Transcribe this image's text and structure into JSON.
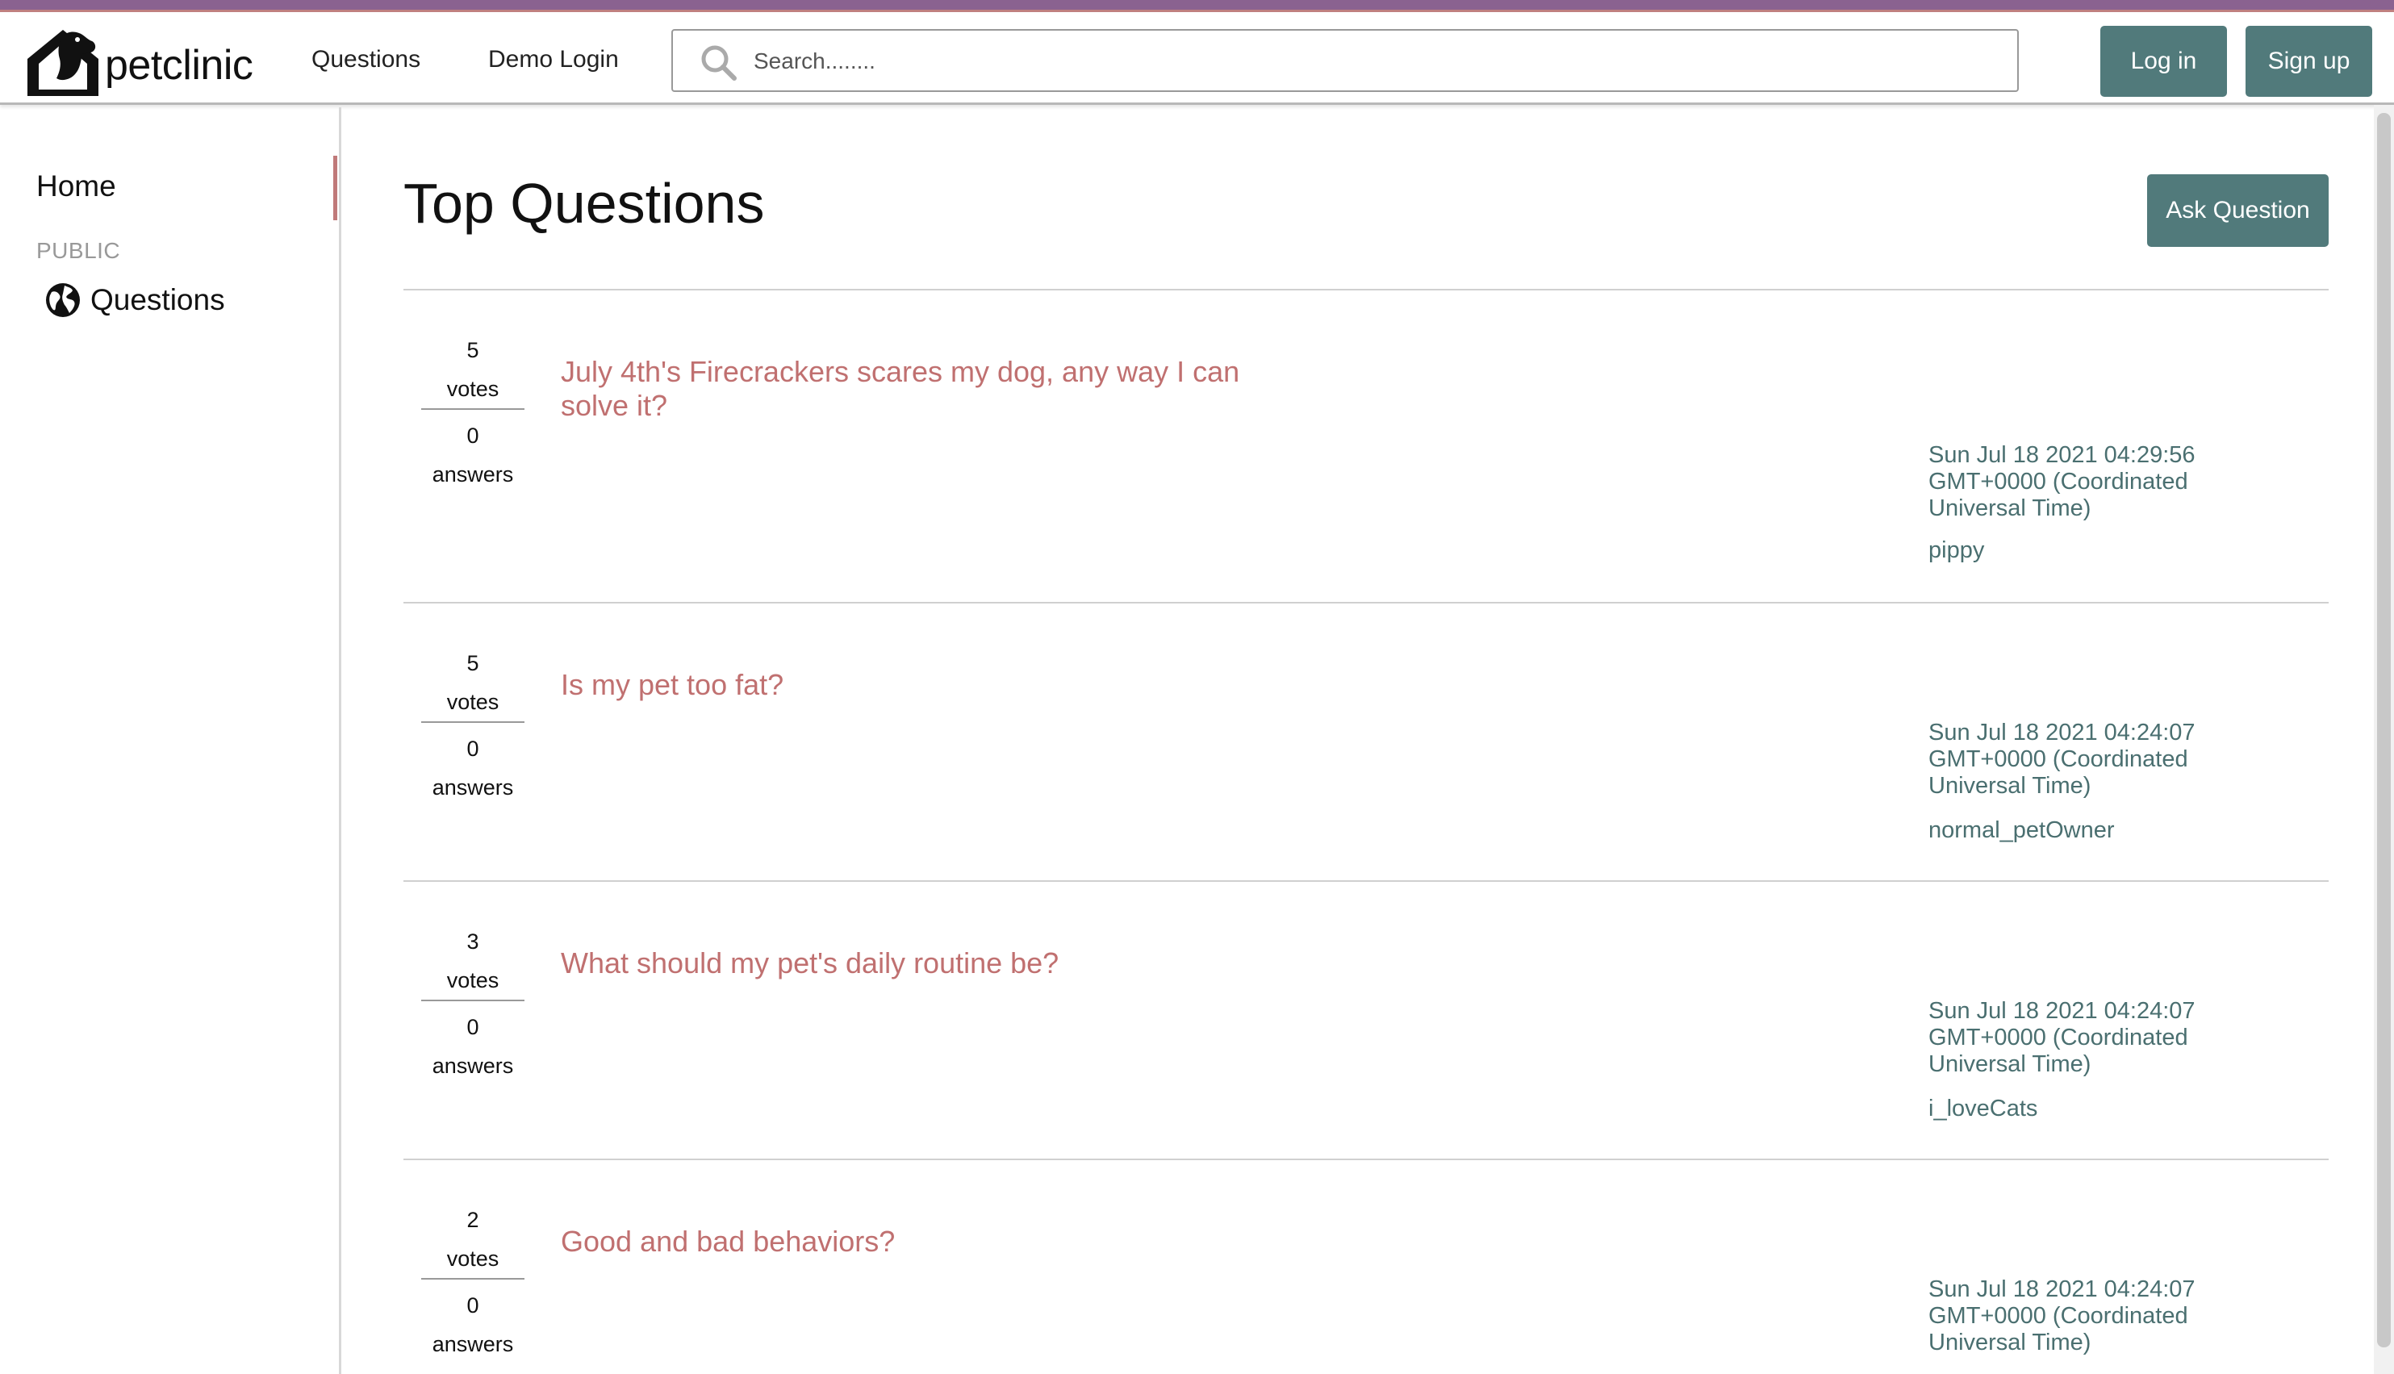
{
  "colors": {
    "accent": "#517a7b",
    "link": "#c07070",
    "meta": "#4a6f70",
    "stripe": "#8a6290"
  },
  "header": {
    "logo_text": "petclinic",
    "nav": {
      "questions": "Questions",
      "demo_login": "Demo Login"
    },
    "search": {
      "placeholder": "Search........",
      "value": ""
    },
    "login_label": "Log in",
    "signup_label": "Sign up"
  },
  "sidebar": {
    "home": "Home",
    "section": "PUBLIC",
    "questions": "Questions"
  },
  "main": {
    "title": "Top Questions",
    "ask_label": "Ask Question",
    "questions": [
      {
        "votes": "5",
        "votes_label": "votes",
        "answers": "0",
        "answers_label": "answers",
        "title": "July 4th's Firecrackers scares my dog, any way I can solve it?",
        "date": "Sun Jul 18 2021 04:29:56 GMT+0000 (Coordinated Universal Time)",
        "user": "pippy"
      },
      {
        "votes": "5",
        "votes_label": "votes",
        "answers": "0",
        "answers_label": "answers",
        "title": "Is my pet too fat?",
        "date": "Sun Jul 18 2021 04:24:07 GMT+0000 (Coordinated Universal Time)",
        "user": "normal_petOwner"
      },
      {
        "votes": "3",
        "votes_label": "votes",
        "answers": "0",
        "answers_label": "answers",
        "title": "What should my pet's daily routine be?",
        "date": "Sun Jul 18 2021 04:24:07 GMT+0000 (Coordinated Universal Time)",
        "user": "i_loveCats"
      },
      {
        "votes": "2",
        "votes_label": "votes",
        "answers": "0",
        "answers_label": "answers",
        "title": "Good and bad behaviors?",
        "date": "Sun Jul 18 2021 04:24:07 GMT+0000 (Coordinated Universal Time)",
        "user": ""
      }
    ]
  }
}
